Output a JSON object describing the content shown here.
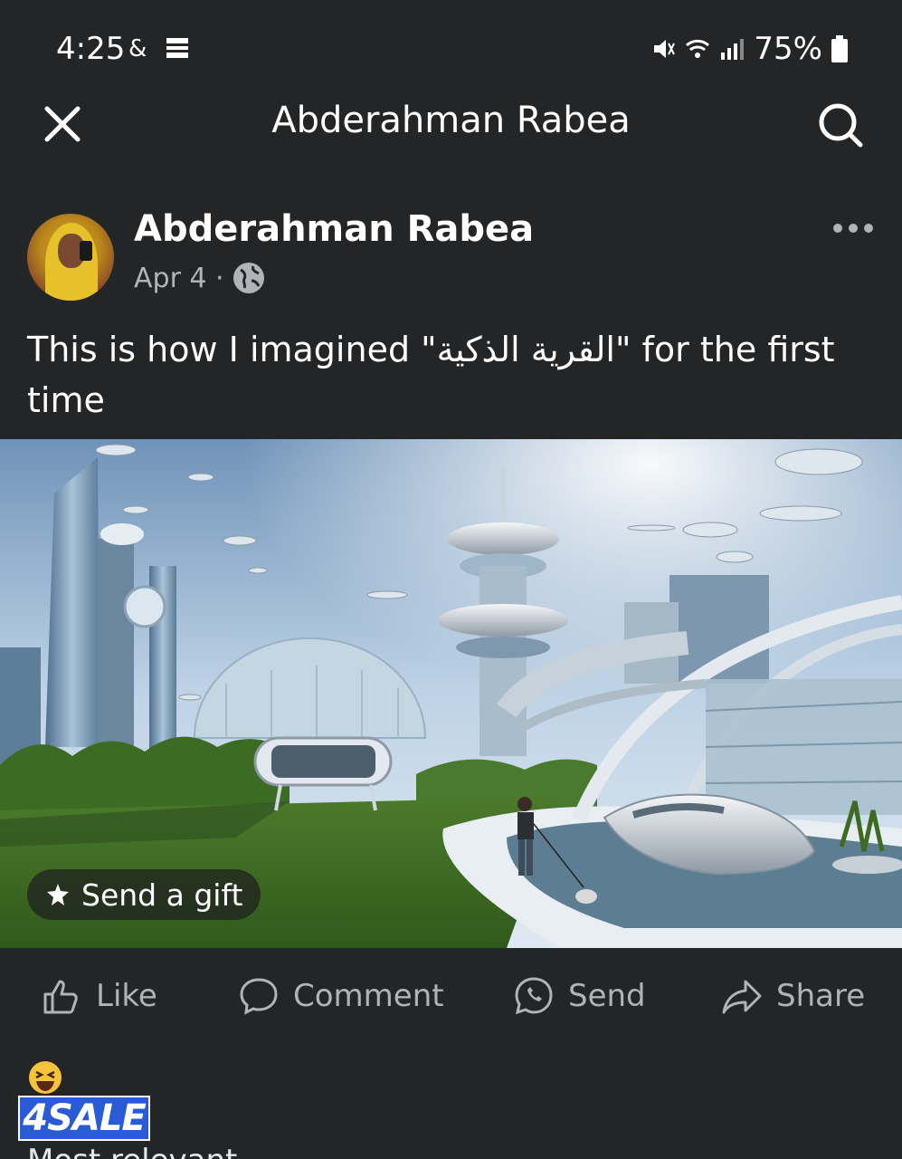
{
  "status_bar": {
    "time": "4:25",
    "battery": "75%"
  },
  "header": {
    "title": "Abderahman Rabea"
  },
  "post": {
    "author": "Abderahman Rabea",
    "date": "Apr 4 ·",
    "text_line1": "This is how I imagined \"القرية الذكية\" for the first",
    "text_line2": "time",
    "gift_label": "Send a gift"
  },
  "actions": {
    "like": "Like",
    "comment": "Comment",
    "send": "Send",
    "share": "Share"
  },
  "watermark": "4SALE",
  "comments": {
    "sort_label": "Most relevant"
  },
  "icons": [
    "close-icon",
    "search-icon",
    "more-icon",
    "globe-icon",
    "gift-icon",
    "like-icon",
    "comment-icon",
    "messenger-icon",
    "share-icon"
  ]
}
